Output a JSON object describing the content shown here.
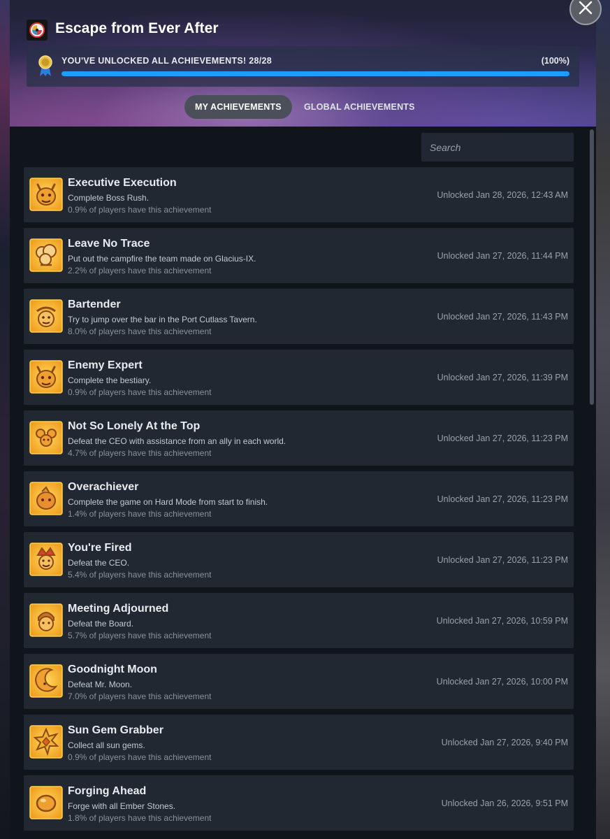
{
  "game": {
    "title": "Escape from Ever After",
    "icon": "game-icon"
  },
  "progress": {
    "label": "YOU'VE UNLOCKED ALL ACHIEVEMENTS! 28/28",
    "percent_label": "(100%)",
    "fraction": 1.0,
    "accent": "#1a9fff"
  },
  "tabs": [
    {
      "label": "MY ACHIEVEMENTS",
      "active": true
    },
    {
      "label": "GLOBAL ACHIEVEMENTS",
      "active": false
    }
  ],
  "search": {
    "placeholder": "Search"
  },
  "achievements": [
    {
      "title": "Executive Execution",
      "desc": "Complete Boss Rush.",
      "pct": "0.9% of players have this achievement",
      "date": "Unlocked Jan 28, 2026, 12:43 AM",
      "icon": "demon-face-icon"
    },
    {
      "title": "Leave No Trace",
      "desc": "Put out the campfire the team made on Glacius-IX.",
      "pct": "2.2% of players have this achievement",
      "date": "Unlocked Jan 27, 2026, 11:44 PM",
      "icon": "smoke-cloud-icon"
    },
    {
      "title": "Bartender",
      "desc": "Try to jump over the bar in the Port Cutlass Tavern.",
      "pct": "8.0% of players have this achievement",
      "date": "Unlocked Jan 27, 2026, 11:43 PM",
      "icon": "pirate-face-icon"
    },
    {
      "title": "Enemy Expert",
      "desc": "Complete the bestiary.",
      "pct": "0.9% of players have this achievement",
      "date": "Unlocked Jan 27, 2026, 11:39 PM",
      "icon": "demon-face-icon"
    },
    {
      "title": "Not So Lonely At the Top",
      "desc": "Defeat the CEO with assistance from an ally in each world.",
      "pct": "4.7% of players have this achievement",
      "date": "Unlocked Jan 27, 2026, 11:23 PM",
      "icon": "ally-group-icon"
    },
    {
      "title": "Overachiever",
      "desc": "Complete the game on Hard Mode from start to finish.",
      "pct": "1.4% of players have this achievement",
      "date": "Unlocked Jan 27, 2026, 11:23 PM",
      "icon": "creature-face-icon"
    },
    {
      "title": "You're Fired",
      "desc": "Defeat the CEO.",
      "pct": "5.4% of players have this achievement",
      "date": "Unlocked Jan 27, 2026, 11:23 PM",
      "icon": "jester-face-icon"
    },
    {
      "title": "Meeting Adjourned",
      "desc": "Defeat the Board.",
      "pct": "5.7% of players have this achievement",
      "date": "Unlocked Jan 27, 2026, 10:59 PM",
      "icon": "board-member-icon"
    },
    {
      "title": "Goodnight Moon",
      "desc": "Defeat Mr. Moon.",
      "pct": "7.0% of players have this achievement",
      "date": "Unlocked Jan 27, 2026, 10:00 PM",
      "icon": "moon-icon"
    },
    {
      "title": "Sun Gem Grabber",
      "desc": "Collect all sun gems.",
      "pct": "0.9% of players have this achievement",
      "date": "Unlocked Jan 27, 2026, 9:40 PM",
      "icon": "sun-gem-icon"
    },
    {
      "title": "Forging Ahead",
      "desc": "Forge with all Ember Stones.",
      "pct": "1.8% of players have this achievement",
      "date": "Unlocked Jan 26, 2026, 9:51 PM",
      "icon": "ember-stone-icon"
    }
  ]
}
